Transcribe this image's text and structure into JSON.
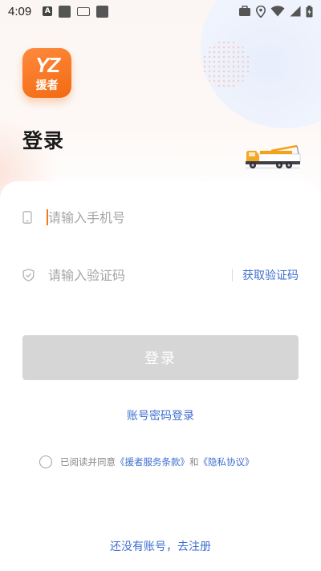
{
  "status_bar": {
    "time": "4:09",
    "icons": [
      "a-icon",
      "square-icon",
      "keyboard-icon",
      "square-icon",
      "briefcase-icon",
      "location-icon",
      "wifi-icon",
      "signal-icon",
      "battery-icon"
    ]
  },
  "brand": {
    "logo_top": "YZ",
    "logo_bottom": "援者",
    "accent": "#f26a12"
  },
  "header": {
    "title": "登录"
  },
  "form": {
    "phone_placeholder": "请输入手机号",
    "code_placeholder": "请输入验证码",
    "get_code": "获取验证码",
    "login_button": "登录",
    "password_login": "账号密码登录"
  },
  "agreement": {
    "prefix": "已阅读并同意",
    "terms": "《援者服务条款》",
    "and": "和",
    "privacy": "《隐私协议》"
  },
  "footer": {
    "register": "还没有账号，去注册"
  },
  "colors": {
    "link": "#3f6fd1",
    "button_disabled": "#d6d6d6"
  }
}
